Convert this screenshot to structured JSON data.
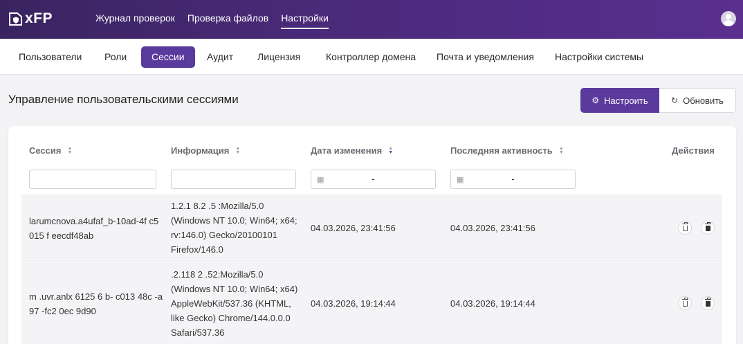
{
  "app": {
    "logo_text": "xFP"
  },
  "topnav": [
    {
      "label": "Журнал проверок"
    },
    {
      "label": "Проверка файлов"
    },
    {
      "label": "Настройки"
    }
  ],
  "subnav": [
    {
      "label": "Пользователи"
    },
    {
      "label": "Роли"
    },
    {
      "label": "Сессии"
    },
    {
      "label": "Аудит"
    },
    {
      "label": "Лицензия"
    },
    {
      "label": "Контроллер домена"
    },
    {
      "label": "Почта и уведомления"
    },
    {
      "label": "Настройки системы"
    }
  ],
  "page": {
    "title": "Управление пользовательскими сессиями",
    "configure_label": "Настроить",
    "refresh_label": "Обновить"
  },
  "table": {
    "columns": [
      {
        "label": "Сессия"
      },
      {
        "label": "Информация"
      },
      {
        "label": "Дата изменения"
      },
      {
        "label": "Последняя активность"
      },
      {
        "label": "Действия"
      }
    ],
    "date_filter_dash": "-",
    "rows": [
      {
        "session": "larumcnova.a4ufaf_b-10ad-4f c5 015 f eecdf48ab",
        "info": "1.2.1 8.2 .5 :Mozilla/5.0 (Windows NT 10.0; Win64; x64; rv:146.0) Gecko/20100101 Firefox/146.0",
        "modified": "04.03.2026, 23:41:56",
        "last_activity": "04.03.2026, 23:41:56"
      },
      {
        "session": "m .uvr.anlx 6125 6 b- c013 48c -a97 -fc2 0ec 9d90",
        "info": ".2.118 2 .52:Mozilla/5.0 (Windows NT 10.0; Win64; x64) AppleWebKit/537.36 (KHTML, like Gecko) Chrome/144.0.0.0 Safari/537.36",
        "modified": "04.03.2026, 19:14:44",
        "last_activity": "04.03.2026, 19:14:44"
      }
    ]
  },
  "colors": {
    "accent": "#5b3a9e",
    "topbar_start": "#3a2460",
    "topbar_end": "#5a2f8f"
  },
  "icons": [
    "logo-shield-icon",
    "user-avatar-icon",
    "gear-icon",
    "refresh-icon",
    "sort-icon",
    "calendar-icon",
    "trash-icon"
  ]
}
